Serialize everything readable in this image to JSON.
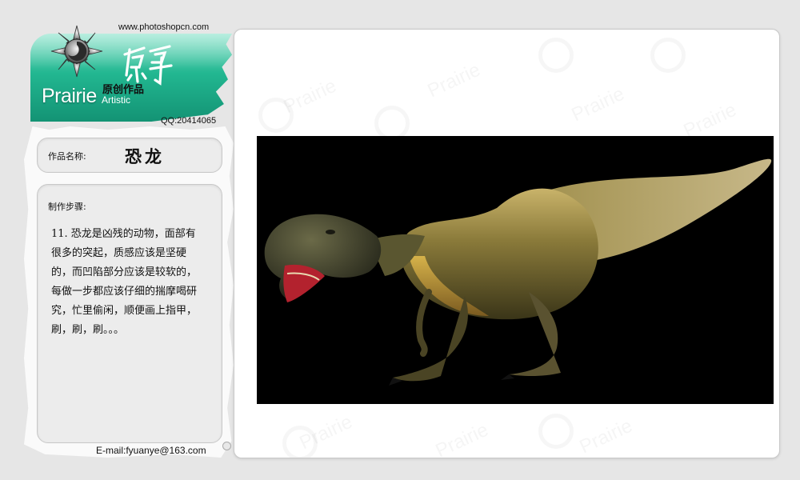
{
  "header": {
    "site_url": "www.photoshopcn.com",
    "brand_word": "Prairie",
    "brand_sub": "Artistic",
    "brand_cn": "原创作品",
    "calligraphy": "原野",
    "qq": "QQ:20414065"
  },
  "sidebar": {
    "title_label": "作品名称:",
    "title_value": "恐龙",
    "steps_label": "制作步骤:",
    "steps_text": "11. 恐龙是凶残的动物，面部有很多的突起，质感应该是坚硬的，而凹陷部分应该是较软的，每做一步都应该仔细的揣摩喝研究，忙里偷闲，顺便画上指甲，刷，刷，刷。。。",
    "email": "E-mail:fyuanye@163.com"
  },
  "content": {
    "watermark": "Prairie",
    "artwork_icon": "tyrannosaurus-illustration"
  },
  "colors": {
    "banner_green": "#22b791",
    "page_bg": "#e6e6e6",
    "artwork_bg": "#000000"
  }
}
